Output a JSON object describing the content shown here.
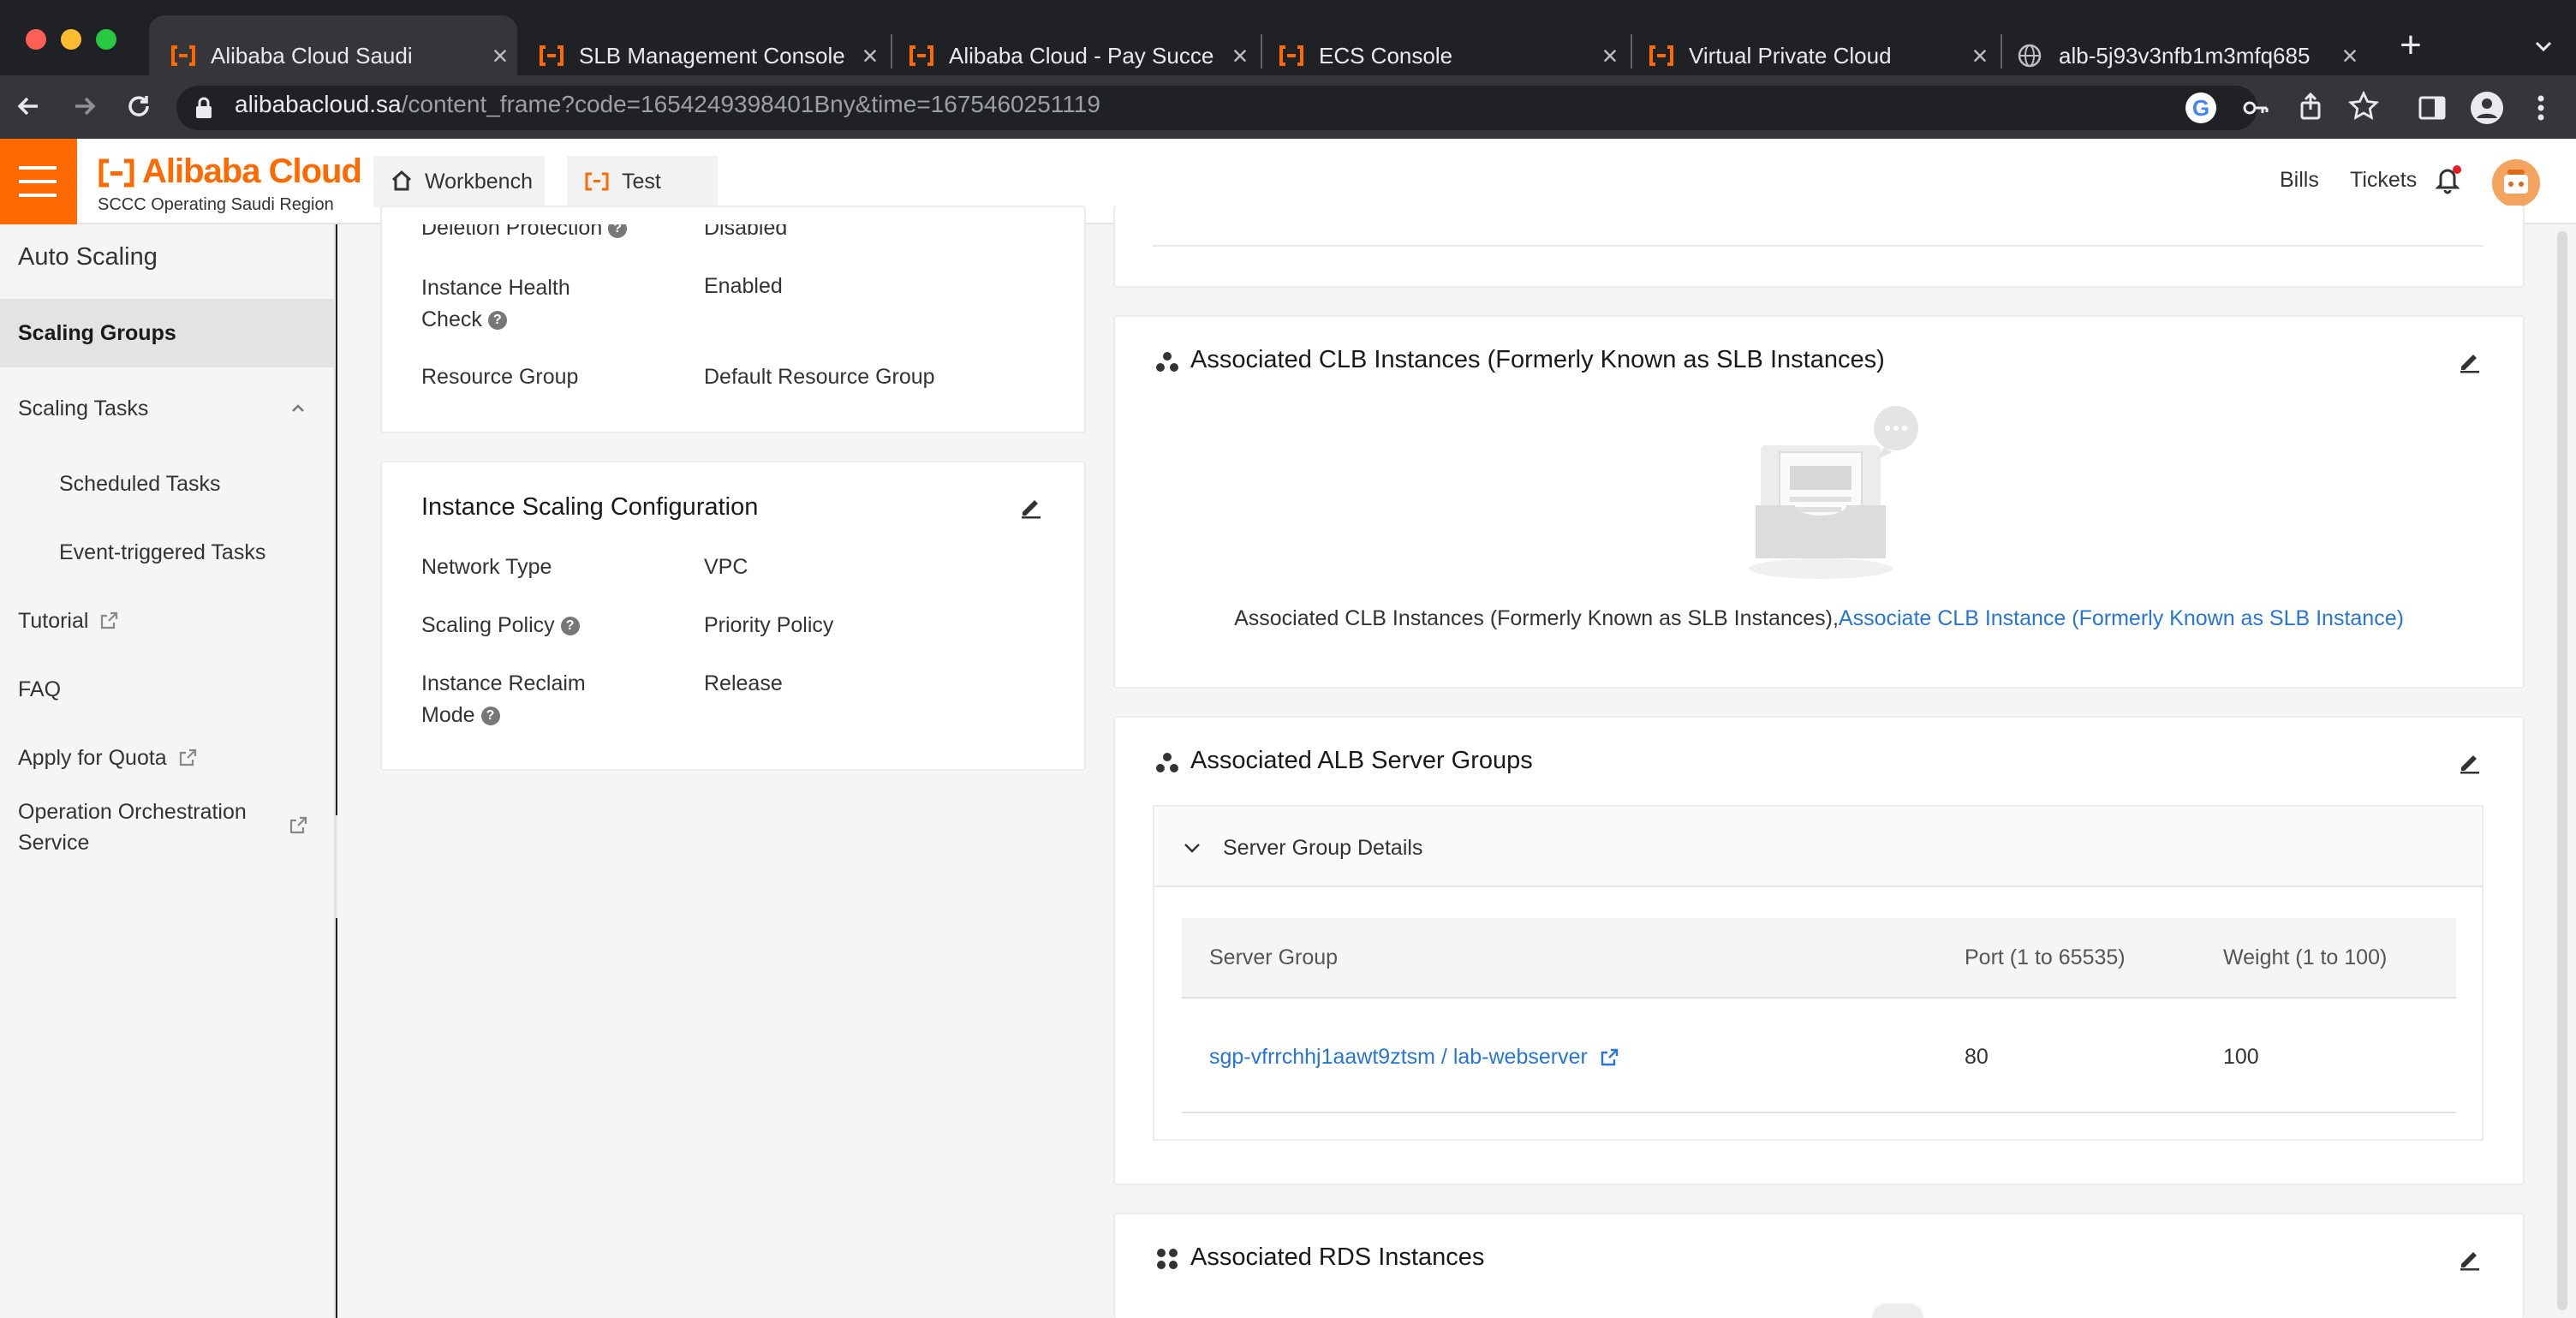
{
  "browser": {
    "tabs": [
      {
        "title": "Alibaba Cloud Saudi",
        "active": true
      },
      {
        "title": "SLB Management Console",
        "active": false
      },
      {
        "title": "Alibaba Cloud - Pay Succe",
        "active": false
      },
      {
        "title": "ECS Console",
        "active": false
      },
      {
        "title": "Virtual Private Cloud",
        "active": false
      },
      {
        "title": "alb-5j93v3nfb1m3mfq685",
        "active": false
      }
    ],
    "url_host": "alibabacloud.sa",
    "url_path": "/content_frame?code=1654249398401Bny&time=1675460251119"
  },
  "header": {
    "logo": "Alibaba Cloud",
    "region": "SCCC Operating Saudi Region",
    "workbench": "Workbench",
    "project": "Test",
    "bills": "Bills",
    "tickets": "Tickets"
  },
  "sidebar": {
    "title": "Auto Scaling",
    "items": [
      {
        "label": "Scaling Groups"
      },
      {
        "label": "Scaling Tasks"
      },
      {
        "label": "Scheduled Tasks"
      },
      {
        "label": "Event-triggered Tasks"
      },
      {
        "label": "Tutorial"
      },
      {
        "label": "FAQ"
      },
      {
        "label": "Apply for Quota"
      },
      {
        "label": "Operation Orchestration Service"
      }
    ]
  },
  "basic": {
    "rows": [
      {
        "label": "Deletion Protection",
        "value": "Disabled"
      },
      {
        "label": "Instance Health Check",
        "value": "Enabled"
      },
      {
        "label": "Resource Group",
        "value": "Default Resource Group"
      }
    ]
  },
  "scaling_config": {
    "title": "Instance Scaling Configuration",
    "rows": [
      {
        "label": "Network Type",
        "value": "VPC"
      },
      {
        "label": "Scaling Policy",
        "value": "Priority Policy"
      },
      {
        "label": "Instance Reclaim Mode",
        "value": "Release"
      }
    ]
  },
  "clb": {
    "title": "Associated CLB Instances (Formerly Known as SLB Instances)",
    "empty_text": "Associated CLB Instances (Formerly Known as SLB Instances),",
    "link": "Associate CLB Instance (Formerly Known as SLB Instance)"
  },
  "alb": {
    "title": "Associated ALB Server Groups",
    "details_label": "Server Group Details",
    "columns": [
      "Server Group",
      "Port (1 to 65535)",
      "Weight (1 to 100)"
    ],
    "rows": [
      {
        "server_group": "sgp-vfrrchhj1aawt9ztsm / lab-webserver",
        "port": "80",
        "weight": "100"
      }
    ]
  },
  "rds": {
    "title": "Associated RDS Instances"
  }
}
